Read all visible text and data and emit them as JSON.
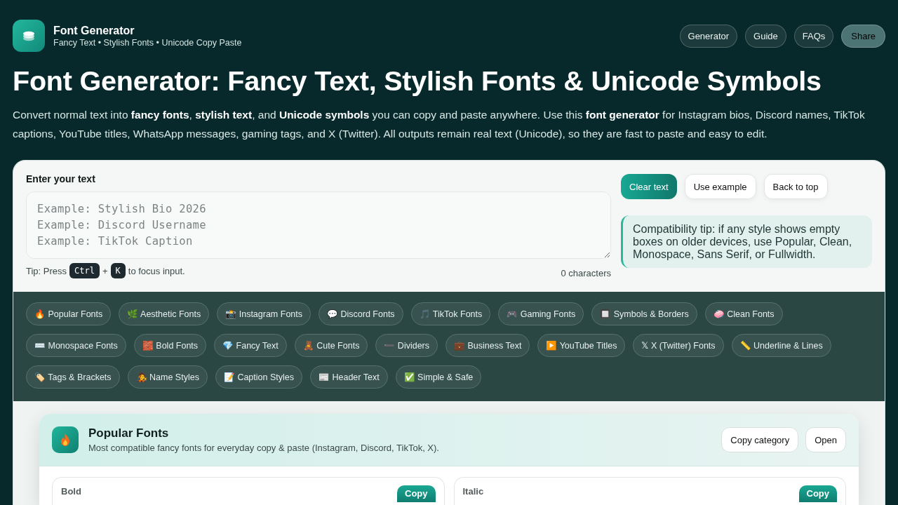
{
  "header": {
    "title": "Font Generator",
    "subtitle": "Fancy Text • Stylish Fonts • Unicode Copy Paste",
    "nav": [
      {
        "label": "Generator",
        "kind": "link"
      },
      {
        "label": "Guide",
        "kind": "link"
      },
      {
        "label": "FAQs",
        "kind": "link"
      },
      {
        "label": "Share",
        "kind": "button"
      }
    ]
  },
  "hero": {
    "title": "Font Generator: Fancy Text, Stylish Fonts & Unicode Symbols",
    "intro": "Convert normal text into **fancy fonts**, **stylish text**, and **Unicode symbols** you can copy and paste anywhere. Use this **font generator** for Instagram bios, Discord names, TikTok captions, YouTube titles, WhatsApp messages, gaming tags, and X (Twitter). All outputs remain real text (Unicode), so they are fast to paste and easy to edit."
  },
  "input": {
    "label": "Enter your text",
    "placeholder": "Example: Stylish Bio 2026\nExample: Discord Username\nExample: TikTok Caption",
    "tip": [
      {
        "kind": "text",
        "text": "Tip: Press"
      },
      {
        "kind": "key",
        "text": "Ctrl"
      },
      {
        "kind": "text",
        "text": "+"
      },
      {
        "kind": "key",
        "text": "K"
      },
      {
        "kind": "text",
        "text": "to focus input."
      }
    ],
    "count": "0 characters"
  },
  "actions": [
    {
      "label": "Clear text",
      "kind": "primary"
    },
    {
      "label": "Use example",
      "kind": "secondary"
    },
    {
      "label": "Back to top",
      "kind": "secondary"
    }
  ],
  "compat_tip": "Compatibility tip: if any style shows empty boxes on older devices, use Popular, Clean, Monospace, Sans Serif, or Fullwidth.",
  "categories": [
    "🔥 Popular Fonts",
    "🌿 Aesthetic Fonts",
    "📸 Instagram Fonts",
    "💬 Discord Fonts",
    "🎵 TikTok Fonts",
    "🎮 Gaming Fonts",
    "🔲 Symbols & Borders",
    "🧼 Clean Fonts",
    "⌨️ Monospace Fonts",
    "🧱 Bold Fonts",
    "💎 Fancy Text",
    "🧸 Cute Fonts",
    "➖ Dividers",
    "💼 Business Text",
    "▶️ YouTube Titles",
    "𝕏 X (Twitter) Fonts",
    "📏 Underline & Lines",
    "🏷️ Tags & Brackets",
    "🧑‍🎤 Name Styles",
    "📝 Caption Styles",
    "📰 Header Text",
    "✅ Simple & Safe"
  ],
  "category_card": {
    "title": "Popular Fonts",
    "description": "Most compatible fancy fonts for everyday copy & paste (Instagram, Discord, TikTok, X).",
    "buttons": [
      "Copy category",
      "Open"
    ],
    "styles": [
      {
        "name": "Bold",
        "button": "Copy"
      },
      {
        "name": "Italic",
        "button": "Copy"
      }
    ]
  }
}
